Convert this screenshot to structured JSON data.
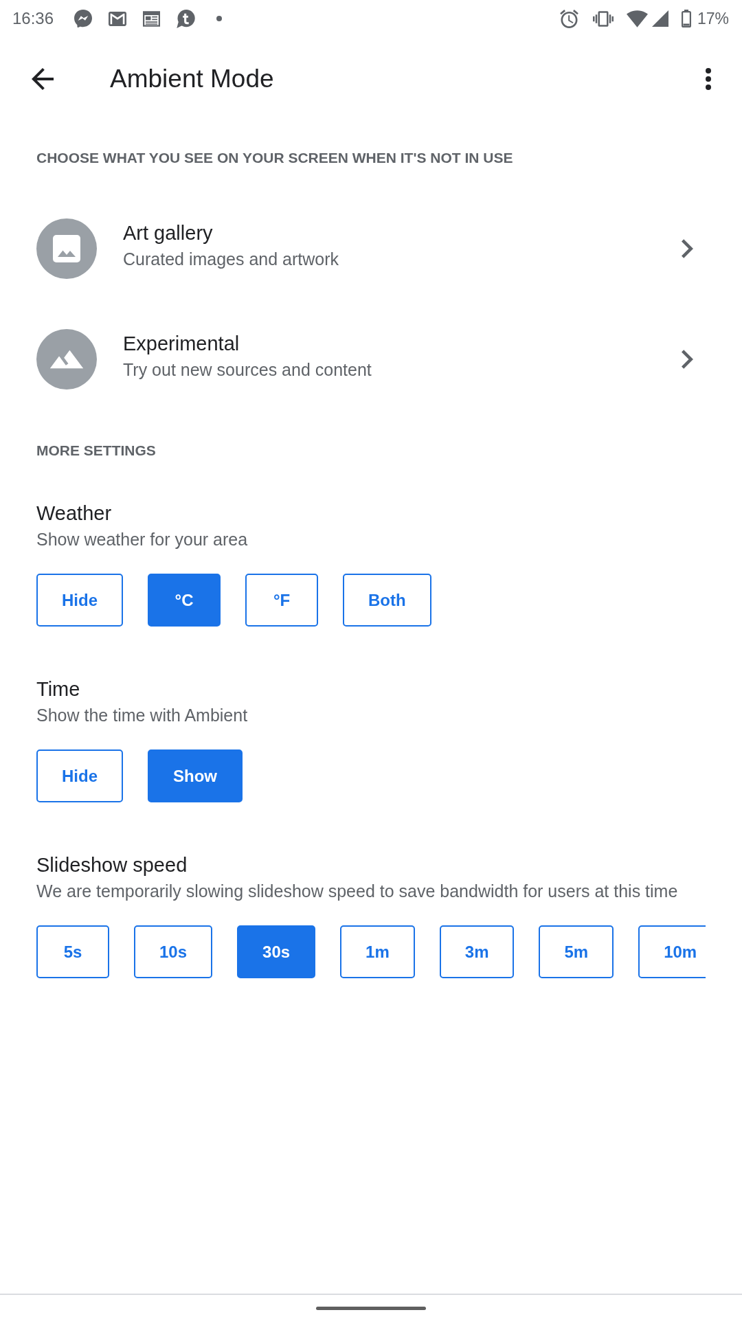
{
  "status_bar": {
    "time": "16:36",
    "battery": "17%"
  },
  "app_bar": {
    "title": "Ambient Mode"
  },
  "sources": {
    "header": "CHOOSE WHAT YOU SEE ON YOUR SCREEN WHEN IT'S NOT IN USE",
    "items": [
      {
        "kind": "image",
        "title": "Art gallery",
        "subtitle": "Curated images and artwork"
      },
      {
        "kind": "mountains",
        "title": "Experimental",
        "subtitle": "Try out new sources and content"
      }
    ]
  },
  "more_settings": {
    "header": "MORE SETTINGS",
    "settings": [
      {
        "title": "Weather",
        "subtitle": "Show weather for your area",
        "options": [
          {
            "label": "Hide",
            "selected": false
          },
          {
            "label": "°C",
            "selected": true
          },
          {
            "label": "°F",
            "selected": false
          },
          {
            "label": "Both",
            "selected": false
          }
        ]
      },
      {
        "title": "Time",
        "subtitle": "Show the time with Ambient",
        "options": [
          {
            "label": "Hide",
            "selected": false
          },
          {
            "label": "Show",
            "selected": true
          }
        ]
      },
      {
        "title": "Slideshow speed",
        "subtitle": "We are temporarily slowing slideshow speed to save bandwidth for users at this time",
        "options": [
          {
            "label": "5s",
            "selected": false
          },
          {
            "label": "10s",
            "selected": false
          },
          {
            "label": "30s",
            "selected": true
          },
          {
            "label": "1m",
            "selected": false
          },
          {
            "label": "3m",
            "selected": false
          },
          {
            "label": "5m",
            "selected": false
          },
          {
            "label": "10m",
            "selected": false
          }
        ]
      }
    ]
  }
}
